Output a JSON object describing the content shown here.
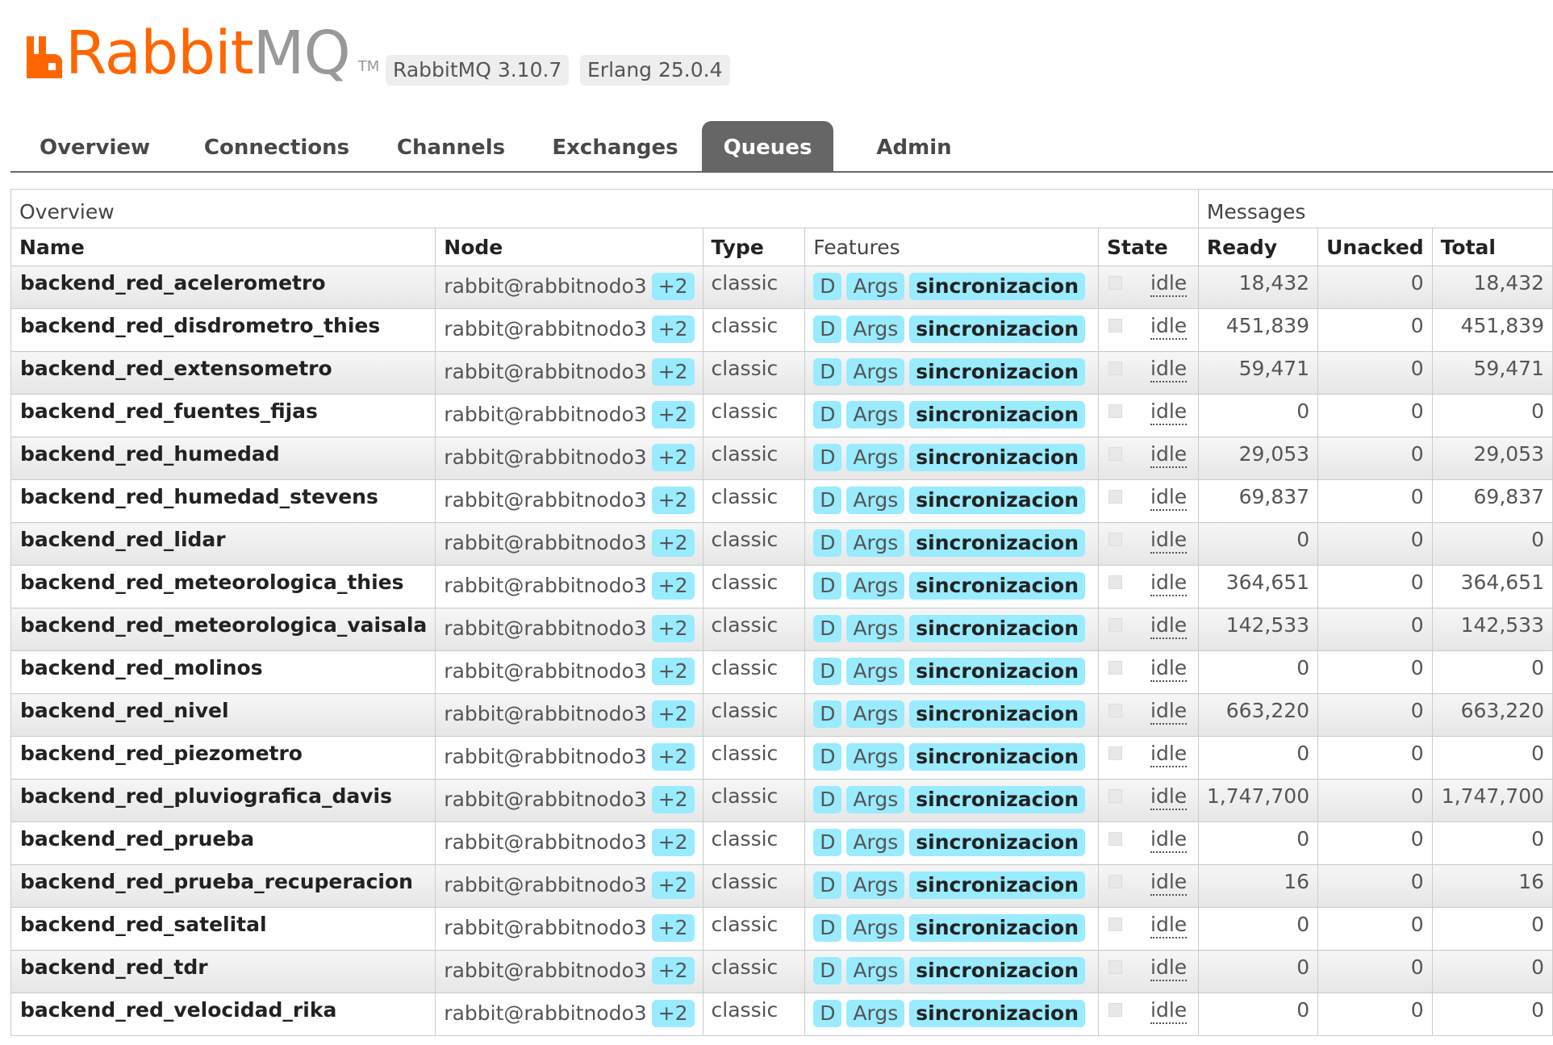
{
  "app": {
    "logo_text": "RabbitMQ",
    "logo_tm": "TM",
    "rabbitmq_version": "RabbitMQ 3.10.7",
    "erlang_version": "Erlang 25.0.4",
    "brand_color": "#ff6600"
  },
  "tabs": [
    {
      "label": "Overview",
      "active": false
    },
    {
      "label": "Connections",
      "active": false
    },
    {
      "label": "Channels",
      "active": false
    },
    {
      "label": "Exchanges",
      "active": false
    },
    {
      "label": "Queues",
      "active": true
    },
    {
      "label": "Admin",
      "active": false
    }
  ],
  "table": {
    "group_overview": "Overview",
    "group_messages": "Messages",
    "columns": {
      "name": "Name",
      "node": "Node",
      "type": "Type",
      "features": "Features",
      "state": "State",
      "ready": "Ready",
      "unacked": "Unacked",
      "total": "Total"
    },
    "rows": [
      {
        "name": "backend_red_acelerometro",
        "node": "rabbit@rabbitnodo3",
        "node_extra": "+2",
        "type": "classic",
        "features": [
          "D",
          "Args"
        ],
        "policy": "sincronizacion",
        "state": "idle",
        "ready": "18,432",
        "unacked": "0",
        "total": "18,432"
      },
      {
        "name": "backend_red_disdrometro_thies",
        "node": "rabbit@rabbitnodo3",
        "node_extra": "+2",
        "type": "classic",
        "features": [
          "D",
          "Args"
        ],
        "policy": "sincronizacion",
        "state": "idle",
        "ready": "451,839",
        "unacked": "0",
        "total": "451,839"
      },
      {
        "name": "backend_red_extensometro",
        "node": "rabbit@rabbitnodo3",
        "node_extra": "+2",
        "type": "classic",
        "features": [
          "D",
          "Args"
        ],
        "policy": "sincronizacion",
        "state": "idle",
        "ready": "59,471",
        "unacked": "0",
        "total": "59,471"
      },
      {
        "name": "backend_red_fuentes_fijas",
        "node": "rabbit@rabbitnodo3",
        "node_extra": "+2",
        "type": "classic",
        "features": [
          "D",
          "Args"
        ],
        "policy": "sincronizacion",
        "state": "idle",
        "ready": "0",
        "unacked": "0",
        "total": "0"
      },
      {
        "name": "backend_red_humedad",
        "node": "rabbit@rabbitnodo3",
        "node_extra": "+2",
        "type": "classic",
        "features": [
          "D",
          "Args"
        ],
        "policy": "sincronizacion",
        "state": "idle",
        "ready": "29,053",
        "unacked": "0",
        "total": "29,053"
      },
      {
        "name": "backend_red_humedad_stevens",
        "node": "rabbit@rabbitnodo3",
        "node_extra": "+2",
        "type": "classic",
        "features": [
          "D",
          "Args"
        ],
        "policy": "sincronizacion",
        "state": "idle",
        "ready": "69,837",
        "unacked": "0",
        "total": "69,837"
      },
      {
        "name": "backend_red_lidar",
        "node": "rabbit@rabbitnodo3",
        "node_extra": "+2",
        "type": "classic",
        "features": [
          "D",
          "Args"
        ],
        "policy": "sincronizacion",
        "state": "idle",
        "ready": "0",
        "unacked": "0",
        "total": "0"
      },
      {
        "name": "backend_red_meteorologica_thies",
        "node": "rabbit@rabbitnodo3",
        "node_extra": "+2",
        "type": "classic",
        "features": [
          "D",
          "Args"
        ],
        "policy": "sincronizacion",
        "state": "idle",
        "ready": "364,651",
        "unacked": "0",
        "total": "364,651"
      },
      {
        "name": "backend_red_meteorologica_vaisala",
        "node": "rabbit@rabbitnodo3",
        "node_extra": "+2",
        "type": "classic",
        "features": [
          "D",
          "Args"
        ],
        "policy": "sincronizacion",
        "state": "idle",
        "ready": "142,533",
        "unacked": "0",
        "total": "142,533"
      },
      {
        "name": "backend_red_molinos",
        "node": "rabbit@rabbitnodo3",
        "node_extra": "+2",
        "type": "classic",
        "features": [
          "D",
          "Args"
        ],
        "policy": "sincronizacion",
        "state": "idle",
        "ready": "0",
        "unacked": "0",
        "total": "0"
      },
      {
        "name": "backend_red_nivel",
        "node": "rabbit@rabbitnodo3",
        "node_extra": "+2",
        "type": "classic",
        "features": [
          "D",
          "Args"
        ],
        "policy": "sincronizacion",
        "state": "idle",
        "ready": "663,220",
        "unacked": "0",
        "total": "663,220"
      },
      {
        "name": "backend_red_piezometro",
        "node": "rabbit@rabbitnodo3",
        "node_extra": "+2",
        "type": "classic",
        "features": [
          "D",
          "Args"
        ],
        "policy": "sincronizacion",
        "state": "idle",
        "ready": "0",
        "unacked": "0",
        "total": "0"
      },
      {
        "name": "backend_red_pluviografica_davis",
        "node": "rabbit@rabbitnodo3",
        "node_extra": "+2",
        "type": "classic",
        "features": [
          "D",
          "Args"
        ],
        "policy": "sincronizacion",
        "state": "idle",
        "ready": "1,747,700",
        "unacked": "0",
        "total": "1,747,700"
      },
      {
        "name": "backend_red_prueba",
        "node": "rabbit@rabbitnodo3",
        "node_extra": "+2",
        "type": "classic",
        "features": [
          "D",
          "Args"
        ],
        "policy": "sincronizacion",
        "state": "idle",
        "ready": "0",
        "unacked": "0",
        "total": "0"
      },
      {
        "name": "backend_red_prueba_recuperacion",
        "node": "rabbit@rabbitnodo3",
        "node_extra": "+2",
        "type": "classic",
        "features": [
          "D",
          "Args"
        ],
        "policy": "sincronizacion",
        "state": "idle",
        "ready": "16",
        "unacked": "0",
        "total": "16"
      },
      {
        "name": "backend_red_satelital",
        "node": "rabbit@rabbitnodo3",
        "node_extra": "+2",
        "type": "classic",
        "features": [
          "D",
          "Args"
        ],
        "policy": "sincronizacion",
        "state": "idle",
        "ready": "0",
        "unacked": "0",
        "total": "0"
      },
      {
        "name": "backend_red_tdr",
        "node": "rabbit@rabbitnodo3",
        "node_extra": "+2",
        "type": "classic",
        "features": [
          "D",
          "Args"
        ],
        "policy": "sincronizacion",
        "state": "idle",
        "ready": "0",
        "unacked": "0",
        "total": "0"
      },
      {
        "name": "backend_red_velocidad_rika",
        "node": "rabbit@rabbitnodo3",
        "node_extra": "+2",
        "type": "classic",
        "features": [
          "D",
          "Args"
        ],
        "policy": "sincronizacion",
        "state": "idle",
        "ready": "0",
        "unacked": "0",
        "total": "0"
      }
    ]
  }
}
